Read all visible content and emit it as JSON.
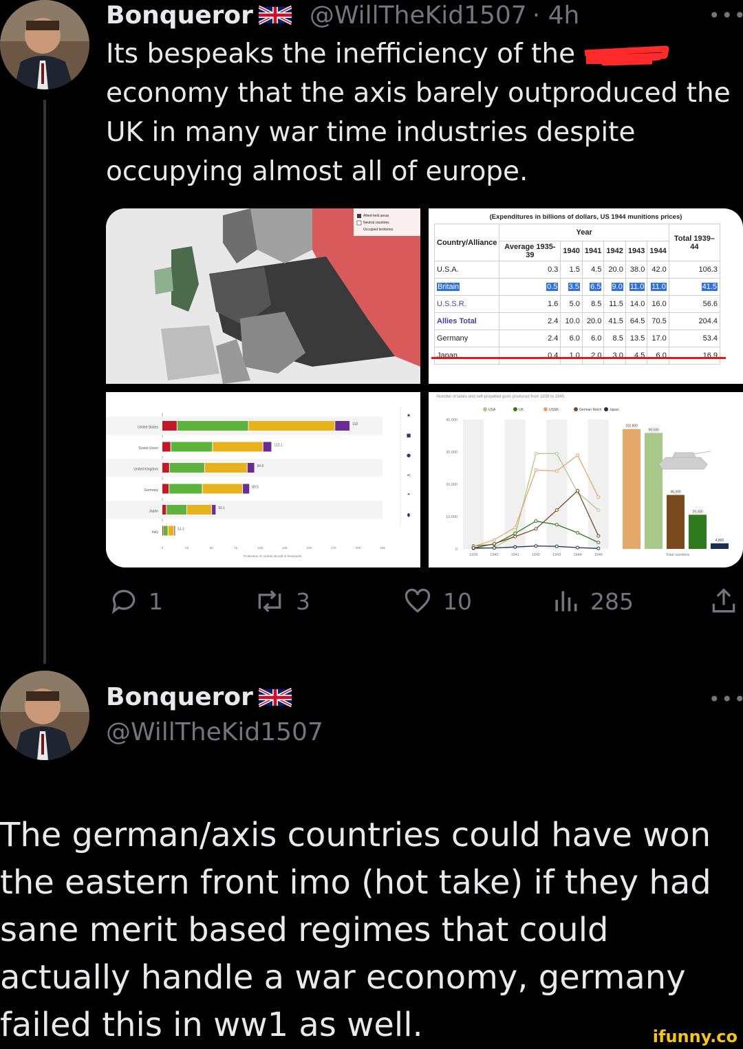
{
  "tweet1": {
    "name": "Bonqueror",
    "handle": "@WillTheKid1507",
    "time": "· 4h",
    "more": "•••",
    "text_pre": "Its bespeaks the inefficiency of the ",
    "text_post": "economy that the axis barely outproduced the UK in many war time industries despite occupying almost all of europe.",
    "actions": {
      "replies": "1",
      "retweets": "3",
      "likes": "10",
      "views": "285"
    }
  },
  "tweet2": {
    "name": "Bonqueror",
    "handle": "@WillTheKid1507",
    "more": "•••",
    "text": "The german/axis countries could have won the eastern front imo (hot take) if they had sane merit based regimes that could actually handle a war economy, germany failed this in ww1 as well."
  },
  "colors": {
    "background": "#000000",
    "text": "#e7e9ea",
    "muted": "#71767b",
    "redline": "#e01818"
  },
  "munitions_table": {
    "caption": "(Expenditures in billions of dollars, US 1944 munitions prices)",
    "year_header": "Year",
    "headers": [
      "Country/Alliance",
      "Average 1935-39",
      "1940",
      "1941",
      "1942",
      "1943",
      "1944",
      "Total 1939–44"
    ],
    "rows": [
      {
        "country": "U.S.A.",
        "values": [
          "0.3",
          "1.5",
          "4.5",
          "20.0",
          "38.0",
          "42.0",
          "106.3"
        ]
      },
      {
        "country": "Britain",
        "values": [
          "0.5",
          "3.5",
          "6.5",
          "9.0",
          "11.0",
          "11.0",
          "41.5"
        ],
        "highlight": true
      },
      {
        "country": "U.S.S.R.",
        "values": [
          "1.6",
          "5.0",
          "8.5",
          "11.5",
          "14.0",
          "16.0",
          "56.6"
        ]
      },
      {
        "country": "Allies Total",
        "values": [
          "2.4",
          "10.0",
          "20.0",
          "41.5",
          "64.5",
          "70.5",
          "204.4"
        ]
      },
      {
        "country": "Germany",
        "values": [
          "2.4",
          "6.0",
          "6.0",
          "8.5",
          "13.5",
          "17.0",
          "53.4"
        ]
      },
      {
        "country": "Japan",
        "values": [
          "0.4",
          "1.0",
          "2.0",
          "3.0",
          "4.5",
          "6.0",
          "16.9"
        ]
      }
    ]
  },
  "aircraft_chart": {
    "countries": [
      "United States",
      "Soviet Union",
      "United Kingdom",
      "Germany",
      "Japan",
      "Italy"
    ],
    "totals": [
      "192",
      "112.1",
      "94.6",
      "89.5",
      "55.1",
      "13.3"
    ],
    "values": [
      192,
      112.1,
      94.6,
      89.5,
      55.1,
      13.3
    ],
    "max": 225,
    "ticks": [
      "0",
      "25",
      "50",
      "75",
      "100",
      "125",
      "150",
      "175",
      "200",
      "225"
    ],
    "xlabel": "Production of combat aircraft in thousands",
    "segment_colors": [
      "#c0192c",
      "#5db33c",
      "#e8b21c",
      "#6a2c91"
    ]
  },
  "tanks_chart": {
    "title": "Number of tanks and self-propelled guns produced from 1939 to 1945",
    "legend": [
      {
        "name": "USA",
        "color": "#a8c98a"
      },
      {
        "name": "UK",
        "color": "#2f7a1f"
      },
      {
        "name": "USSR",
        "color": "#e3a86a"
      },
      {
        "name": "German Reich",
        "color": "#7a4a1f"
      },
      {
        "name": "Japan",
        "color": "#1a2f4f"
      }
    ],
    "y_ticks": [
      "40,000",
      "30,000",
      "20,000",
      "10,000",
      "0"
    ],
    "x_ticks": [
      "1939",
      "1940",
      "1941",
      "1942",
      "1943",
      "1944",
      "1945"
    ],
    "ymax": 40000,
    "totals_label": "Total numbers",
    "totals": [
      {
        "label": "102,800",
        "value": 102800,
        "color": "#e3a86a"
      },
      {
        "label": "99,500",
        "value": 99500,
        "color": "#a8c98a"
      },
      {
        "label": "46,300",
        "value": 46300,
        "color": "#7a4a1f"
      },
      {
        "label": "29,300",
        "value": 29300,
        "color": "#2f7a1f"
      },
      {
        "label": "4,800",
        "value": 4800,
        "color": "#1a2f4f"
      }
    ]
  },
  "map_labels": [
    "Allied-held areas",
    "Neutral countries",
    "Occupied territories"
  ],
  "watermark": "ifunny.co"
}
